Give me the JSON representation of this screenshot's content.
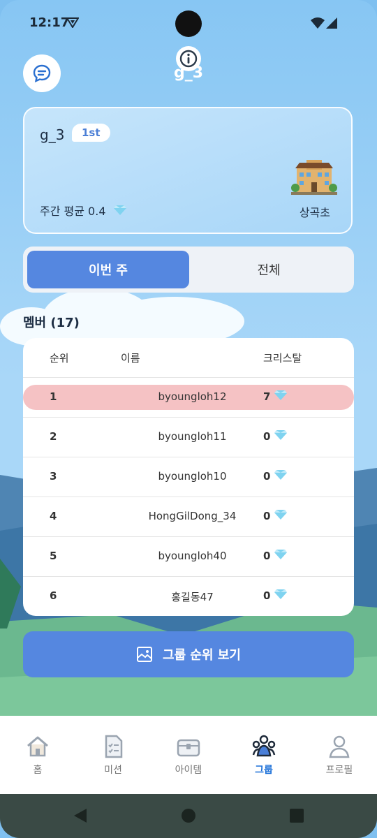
{
  "status": {
    "time": "12:17"
  },
  "header": {
    "title": "g_3",
    "chat_icon": "chat-bubble-icon",
    "info_icon": "info-icon"
  },
  "group_card": {
    "name": "g_3",
    "rank_badge": "1st",
    "weekly_avg": "주간 평균 0.4",
    "school": "상곡초"
  },
  "tabs": {
    "this_week": "이번 주",
    "all": "전체",
    "selected": "this_week"
  },
  "members_label": "멤버 (17)",
  "table": {
    "headers": {
      "rank": "순위",
      "name": "이름",
      "crystal": "크리스탈"
    },
    "rows": [
      {
        "rank": "1",
        "name": "byoungloh12",
        "crystal": "7"
      },
      {
        "rank": "2",
        "name": "byoungloh11",
        "crystal": "0"
      },
      {
        "rank": "3",
        "name": "byoungloh10",
        "crystal": "0"
      },
      {
        "rank": "4",
        "name": "HongGilDong_34",
        "crystal": "0"
      },
      {
        "rank": "5",
        "name": "byoungloh40",
        "crystal": "0"
      },
      {
        "rank": "6",
        "name": "홍길동47",
        "crystal": "0"
      }
    ]
  },
  "cta": {
    "label": "그룹 순위 보기",
    "icon": "image-gallery-icon"
  },
  "nav": [
    {
      "label": "홈",
      "icon": "home-icon"
    },
    {
      "label": "미션",
      "icon": "mission-icon"
    },
    {
      "label": "아이템",
      "icon": "chest-icon"
    },
    {
      "label": "그룹",
      "icon": "group-icon",
      "active": true
    },
    {
      "label": "프로필",
      "icon": "profile-icon"
    }
  ],
  "colors": {
    "accent": "#5587e0",
    "highlight_row": "#f5c2c4",
    "active_nav": "#1a6fd8"
  }
}
